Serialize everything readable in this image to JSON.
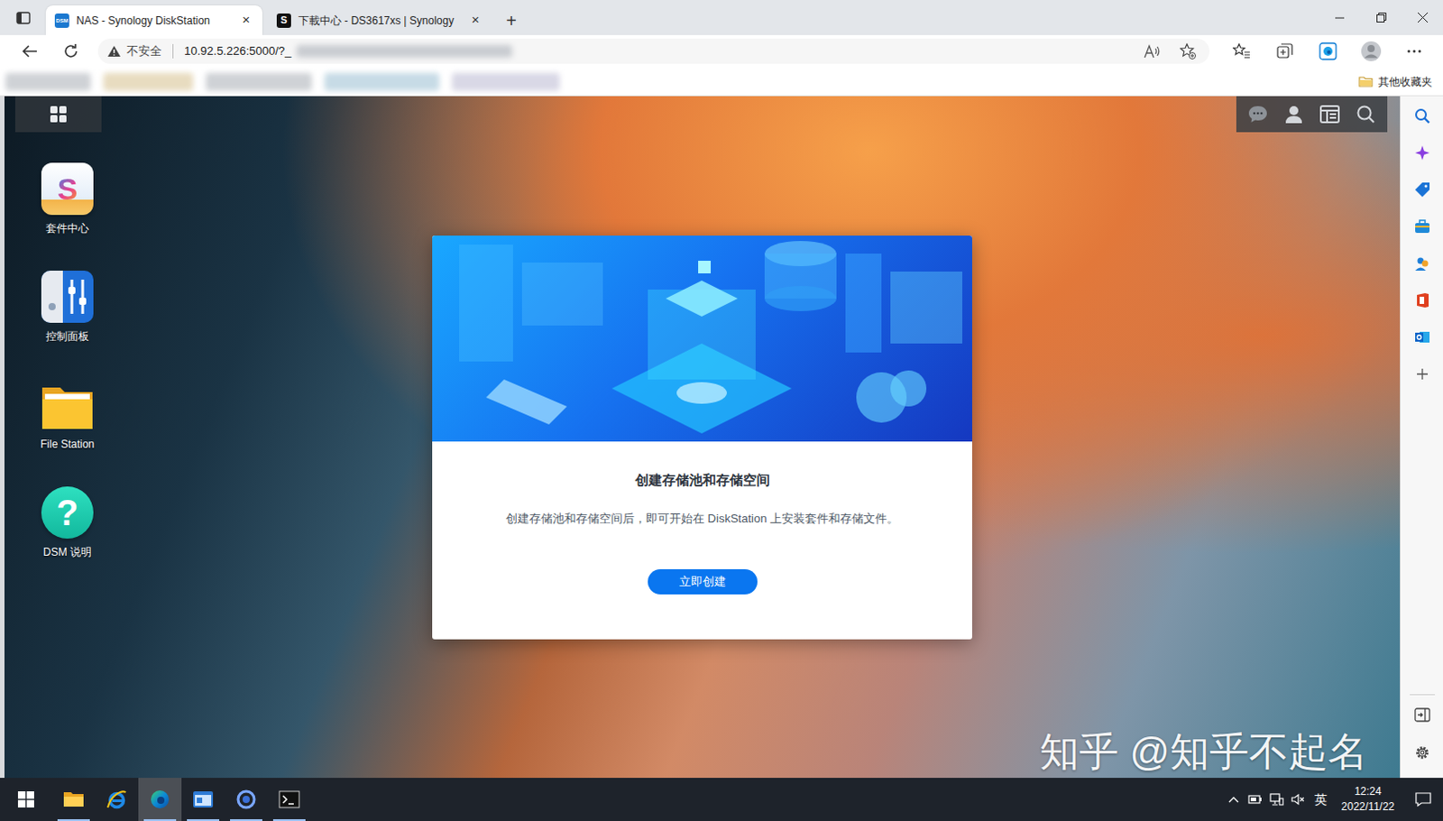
{
  "browser": {
    "tabs": [
      {
        "label": "NAS - Synology DiskStation",
        "selected": true,
        "close": "×",
        "kind": "dsm",
        "favicon": "DSM"
      },
      {
        "label": "下載中心 - DS3617xs | Synology",
        "selected": false,
        "close": "×",
        "kind": "synology",
        "favicon": "S"
      }
    ],
    "new_tab": "+",
    "security": "不安全",
    "url": "10.92.5.226:5000/?_",
    "favorites_folder": "其他收藏夹"
  },
  "desktop": {
    "icons": [
      {
        "label": "套件中心",
        "kind": "package",
        "glyph": "S"
      },
      {
        "label": "控制面板",
        "kind": "control",
        "glyph": ""
      },
      {
        "label": "File Station",
        "kind": "folder",
        "glyph": ""
      },
      {
        "label": "DSM 说明",
        "kind": "help",
        "glyph": "?"
      }
    ]
  },
  "dialog": {
    "title": "创建存储池和存储空间",
    "description": "创建存储池和存储空间后，即可开始在 DiskStation 上安装套件和存储文件。",
    "button": "立即创建"
  },
  "watermark": "知乎 @知乎不起名",
  "taskbar": {
    "apps": [
      {
        "kind": "explorer",
        "running": true,
        "selected": false
      },
      {
        "kind": "ie",
        "running": false,
        "selected": false
      },
      {
        "kind": "edge",
        "running": true,
        "selected": true
      },
      {
        "kind": "window",
        "running": true,
        "selected": false
      },
      {
        "kind": "circle",
        "running": true,
        "selected": false
      },
      {
        "kind": "terminal",
        "running": true,
        "selected": false
      }
    ],
    "tray": {
      "ime": "英",
      "time": "12:24",
      "date": "2022/11/22"
    }
  }
}
